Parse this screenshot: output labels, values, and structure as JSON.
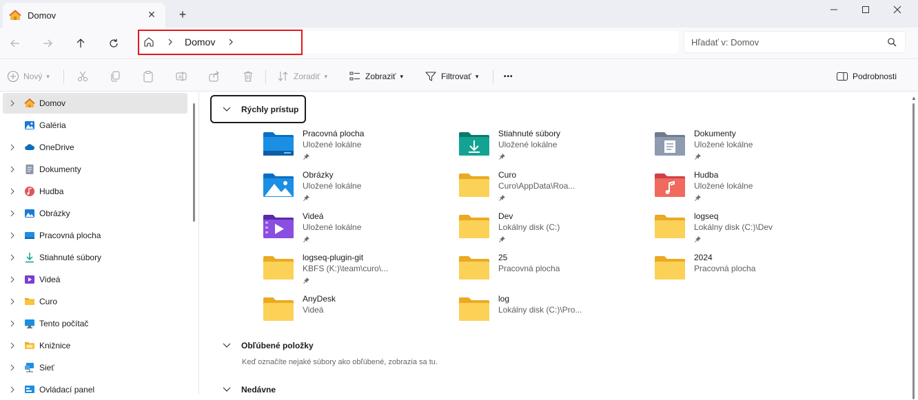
{
  "tab": {
    "title": "Domov",
    "close": "✕",
    "new": "+"
  },
  "window": {
    "minimize": "—",
    "maximize": "☐",
    "close": "✕"
  },
  "address": {
    "segment": "Domov"
  },
  "search": {
    "placeholder": "Hľadať v: Domov"
  },
  "toolbar": {
    "new_label": "Nový",
    "sort_label": "Zoradiť",
    "view_label": "Zobraziť",
    "filter_label": "Filtrovať",
    "more_label": "•••",
    "details_label": "Podrobnosti"
  },
  "sidebar": {
    "items": [
      {
        "label": "Domov",
        "icon": "home-icon"
      },
      {
        "label": "Galéria",
        "icon": "gallery-icon"
      },
      {
        "label": "OneDrive",
        "icon": "cloud-icon"
      },
      {
        "label": "Dokumenty",
        "icon": "documents-icon"
      },
      {
        "label": "Hudba",
        "icon": "music-icon"
      },
      {
        "label": "Obrázky",
        "icon": "pictures-icon"
      },
      {
        "label": "Pracovná plocha",
        "icon": "desktop-icon"
      },
      {
        "label": "Stiahnuté súbory",
        "icon": "downloads-icon"
      },
      {
        "label": "Videá",
        "icon": "videos-icon"
      },
      {
        "label": "Curo",
        "icon": "folder-icon"
      },
      {
        "label": "Tento počítač",
        "icon": "computer-icon"
      },
      {
        "label": "Knižnice",
        "icon": "libraries-icon"
      },
      {
        "label": "Sieť",
        "icon": "network-icon"
      },
      {
        "label": "Ovládací panel",
        "icon": "control-panel-icon"
      }
    ]
  },
  "sections": {
    "quick_access": "Rýchly prístup",
    "favorites": "Obľúbené položky",
    "favorites_empty": "Keď označíte nejaké súbory ako obľúbené, zobrazia sa tu.",
    "recent": "Nedávne"
  },
  "folders": [
    {
      "name": "Pracovná plocha",
      "sub": "Uložené lokálne",
      "pinned": true,
      "icon": "desktop-folder-icon"
    },
    {
      "name": "Stiahnuté súbory",
      "sub": "Uložené lokálne",
      "pinned": true,
      "icon": "downloads-folder-icon"
    },
    {
      "name": "Dokumenty",
      "sub": "Uložené lokálne",
      "pinned": true,
      "icon": "documents-folder-icon"
    },
    {
      "name": "Obrázky",
      "sub": "Uložené lokálne",
      "pinned": true,
      "icon": "pictures-folder-icon"
    },
    {
      "name": "Curo",
      "sub": "Curo\\AppData\\Roa...",
      "pinned": true,
      "icon": "folder-icon"
    },
    {
      "name": "Hudba",
      "sub": "Uložené lokálne",
      "pinned": true,
      "icon": "music-folder-icon"
    },
    {
      "name": "Videá",
      "sub": "Uložené lokálne",
      "pinned": true,
      "icon": "videos-folder-icon"
    },
    {
      "name": "Dev",
      "sub": "Lokálny disk (C:)",
      "pinned": true,
      "icon": "folder-icon"
    },
    {
      "name": "logseq",
      "sub": "Lokálny disk (C:)\\Dev",
      "pinned": true,
      "icon": "folder-icon"
    },
    {
      "name": "logseq-plugin-git",
      "sub": "KBFS (K:)\\team\\curo\\...",
      "pinned": true,
      "icon": "folder-icon"
    },
    {
      "name": "25",
      "sub": "Pracovná plocha",
      "pinned": false,
      "icon": "folder-icon"
    },
    {
      "name": "2024",
      "sub": "Pracovná plocha",
      "pinned": false,
      "icon": "folder-icon"
    },
    {
      "name": "AnyDesk",
      "sub": "Videá",
      "pinned": false,
      "icon": "folder-icon"
    },
    {
      "name": "log",
      "sub": "Lokálny disk (C:)\\Pro...",
      "pinned": false,
      "icon": "folder-icon"
    }
  ],
  "colors": {
    "highlight": "#e3161c",
    "folder": "#f8c53a",
    "accent": "#0067c0"
  }
}
